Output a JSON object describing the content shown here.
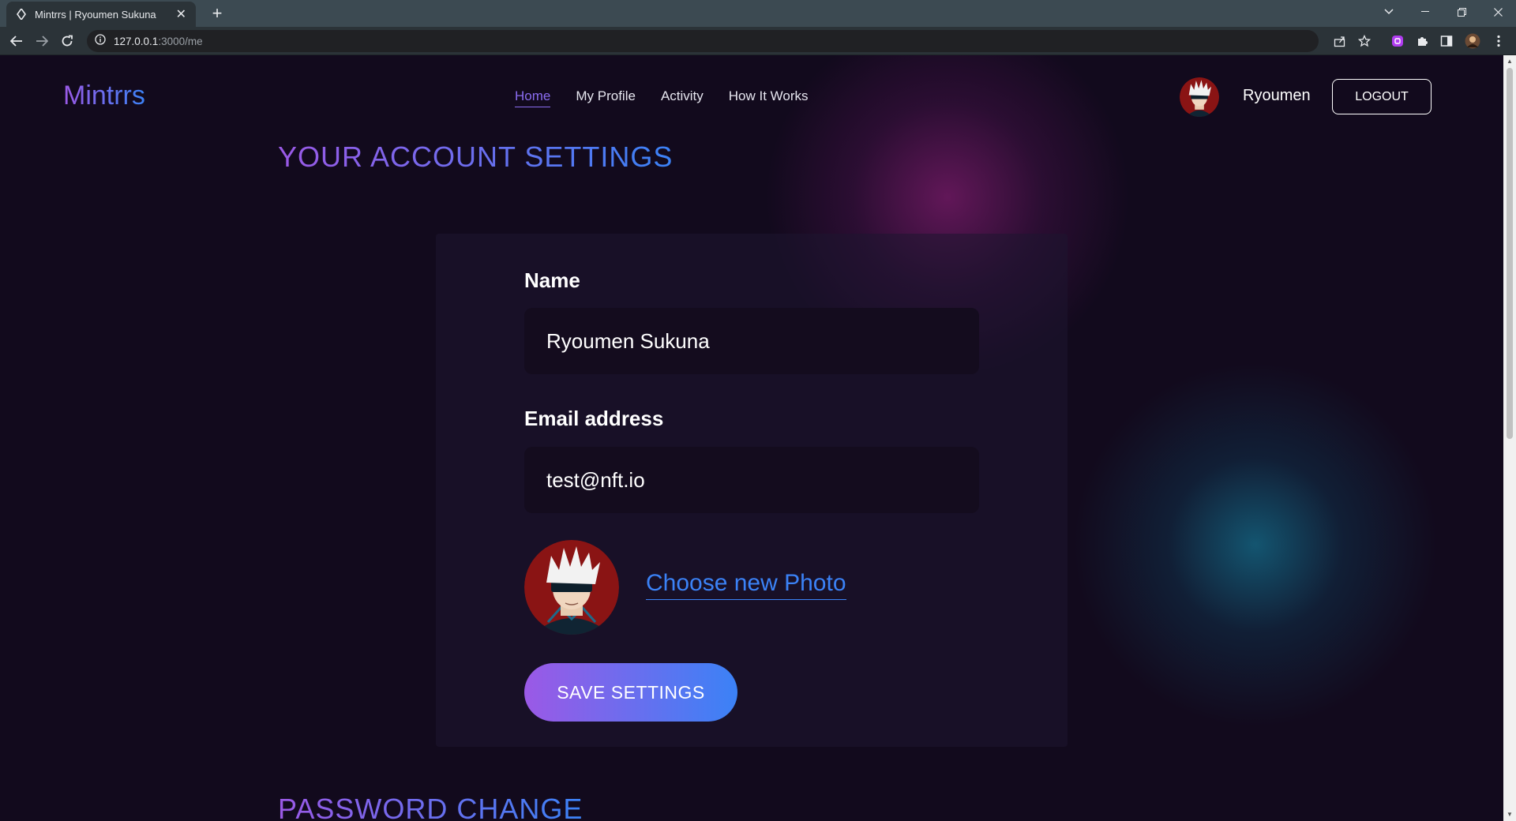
{
  "browser": {
    "tab_title": "Mintrrs | Ryoumen Sukuna",
    "url_host": "127.0.0.1",
    "url_path": ":3000/me"
  },
  "header": {
    "logo": "Mintrrs",
    "nav": [
      {
        "label": "Home",
        "active": true
      },
      {
        "label": "My Profile"
      },
      {
        "label": "Activity"
      },
      {
        "label": "How It Works"
      }
    ],
    "username": "Ryoumen",
    "logout_label": "LOGOUT"
  },
  "settings": {
    "title": "YOUR ACCOUNT SETTINGS",
    "name_label": "Name",
    "name_value": "Ryoumen Sukuna",
    "email_label": "Email address",
    "email_value": "test@nft.io",
    "choose_photo_label": "Choose new Photo",
    "save_label": "SAVE SETTINGS"
  },
  "password": {
    "title": "PASSWORD CHANGE"
  },
  "colors": {
    "gradient_start": "#9b59e6",
    "gradient_end": "#3b82f6",
    "background": "#120a1d",
    "field_bg": "#140c1e"
  }
}
